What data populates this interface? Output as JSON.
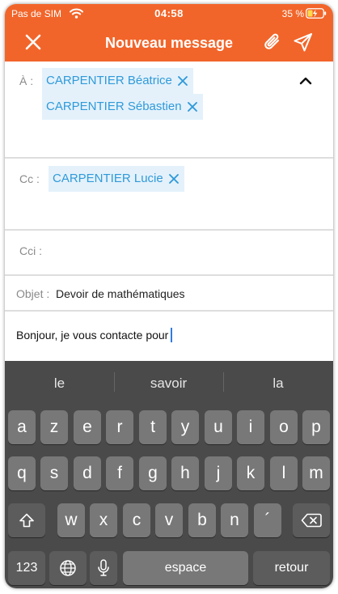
{
  "status_bar": {
    "carrier": "Pas de SIM",
    "time": "04:58",
    "battery_percent": "35 %"
  },
  "nav": {
    "title": "Nouveau message"
  },
  "form": {
    "to_label": "À :",
    "to_recipients": [
      "CARPENTIER Béatrice",
      "CARPENTIER Sébastien"
    ],
    "cc_label": "Cc :",
    "cc_recipients": [
      "CARPENTIER Lucie"
    ],
    "bcc_label": "Cci :",
    "subject_label": "Objet :",
    "subject_value": "Devoir de mathématiques",
    "body": "Bonjour, je vous contacte pour"
  },
  "keyboard": {
    "suggestions": [
      "le",
      "savoir",
      "la"
    ],
    "row1": [
      "a",
      "z",
      "e",
      "r",
      "t",
      "y",
      "u",
      "i",
      "o",
      "p"
    ],
    "row2": [
      "q",
      "s",
      "d",
      "f",
      "g",
      "h",
      "j",
      "k",
      "l",
      "m"
    ],
    "row3": [
      "w",
      "x",
      "c",
      "v",
      "b",
      "n",
      "´"
    ],
    "numbers_key": "123",
    "space_key": "espace",
    "return_key": "retour"
  },
  "colors": {
    "accent": "#f2652a",
    "chip_bg": "#e4f1fb",
    "chip_text": "#2f9ad9",
    "keyboard_bg": "#4a4a4a",
    "key_bg": "#787878"
  }
}
